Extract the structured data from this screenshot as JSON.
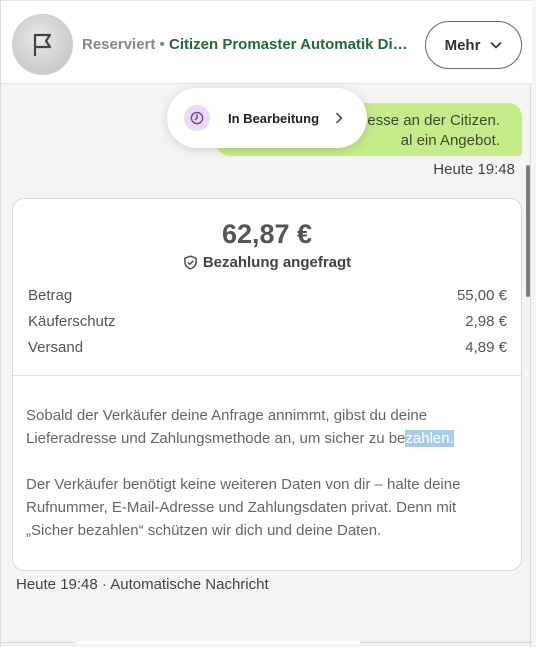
{
  "header": {
    "status": "Reserviert",
    "separator": " • ",
    "item_title": "Citizen Promaster Automatik Di…",
    "more_label": "Mehr"
  },
  "toast": {
    "label": "In Bearbeitung"
  },
  "bubble": {
    "line1": "esse an der Citizen.",
    "line2": "al ein Angebot."
  },
  "message_time": "Heute 19:48",
  "payment": {
    "amount": "62,87 €",
    "status": "Bezahlung angefragt",
    "rows": [
      {
        "label": "Betrag",
        "value": "55,00 €"
      },
      {
        "label": "Käuferschutz",
        "value": "2,98 €"
      },
      {
        "label": "Versand",
        "value": "4,89 €"
      }
    ],
    "para1_main": "Sobald der Verkäufer deine Anfrage annimmt, gibst du deine Lieferadresse und Zahlungsmethode an, um sicher zu be",
    "para1_highlight": "zahlen.",
    "para2": "Der Verkäufer benötigt keine weiteren Daten von dir – halte deine Rufnummer, E-Mail-Adresse und Zahlungsdaten privat. Denn mit „Sicher bezahlen“ schützen wir dich und deine Daten."
  },
  "auto_time": "Heute 19:48 · Automatische Nachricht",
  "icons": [
    "flag-icon",
    "chevron-down-icon",
    "clock-icon",
    "chevron-right-icon",
    "shield-icon"
  ]
}
